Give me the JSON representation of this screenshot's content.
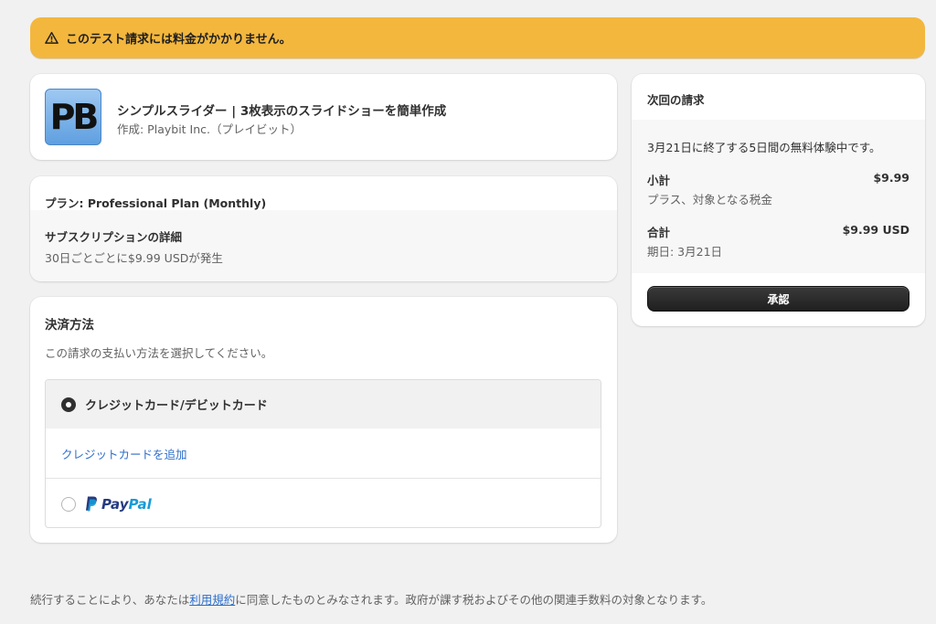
{
  "banner": {
    "text": "このテスト請求には料金がかかりません。",
    "icon": "warning-triangle-icon",
    "color": "#f3b73e"
  },
  "app": {
    "logo_text": "PB",
    "title": "シンプルスライダー | 3枚表示のスライドショーを簡単作成",
    "author": "作成: Playbit Inc.（プレイビット）"
  },
  "plan": {
    "name": "プラン: Professional Plan (Monthly)",
    "details_title": "サブスクリプションの詳細",
    "details_desc": "30日ごとごとに$9.99 USDが発生"
  },
  "payment": {
    "title": "決済方法",
    "description": "この請求の支払い方法を選択してください。",
    "options": [
      {
        "label": "クレジットカード/デビットカード",
        "selected": true
      },
      {
        "label": "PayPal",
        "selected": false
      }
    ],
    "add_card_link": "クレジットカードを追加",
    "paypal_pay": "Pay",
    "paypal_pal": "Pal"
  },
  "summary": {
    "title": "次回の請求",
    "trial_text": "3月21日に終了する5日間の無料体験中です。",
    "subtotal_label": "小計",
    "subtotal_value": "$9.99",
    "subtotal_note": "プラス、対象となる税金",
    "total_label": "合計",
    "total_value": "$9.99 USD",
    "due_note": "期日: 3月21日",
    "approve_label": "承認"
  },
  "footer": {
    "before": "続行することにより、あなたは",
    "link": "利用規約",
    "after": "に同意したものとみなされます。政府が課す税およびその他の関連手数料の対象となります。"
  },
  "colors": {
    "accent_link": "#2c6ecb",
    "background": "#f1f1f1",
    "button_dark": "#303030"
  }
}
